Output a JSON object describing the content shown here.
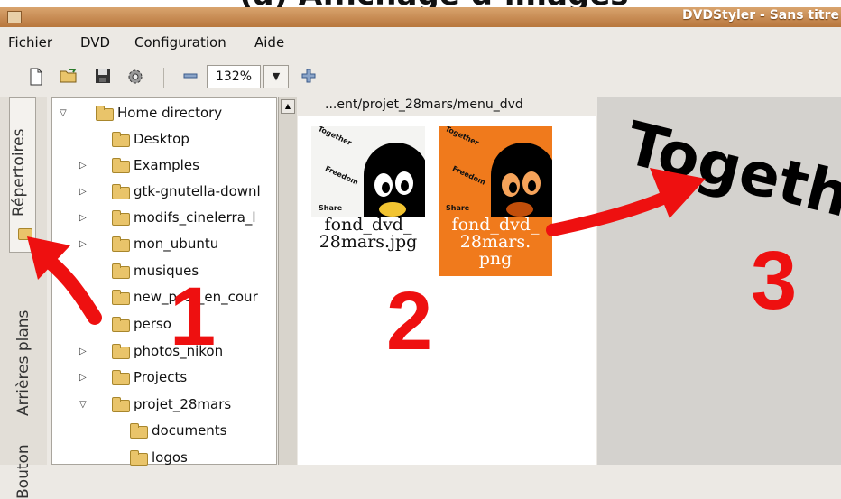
{
  "banner": {
    "text": "(a) Affichage d’images"
  },
  "window": {
    "title": "DVDStyler - Sans titre"
  },
  "menu": [
    "Fichier",
    "DVD",
    "Configuration",
    "Aide"
  ],
  "toolbar": {
    "icons": [
      "new-file-icon",
      "open-folder-icon",
      "save-icon",
      "settings-icon",
      "zoom-out-icon",
      "zoom-in-icon"
    ],
    "zoom_value": "132%"
  },
  "side_tabs": [
    "Répertoires",
    "Arrières plans",
    "Boutons"
  ],
  "tree": [
    {
      "label": "Home directory",
      "expanded": true
    },
    {
      "label": "Desktop"
    },
    {
      "label": "Examples"
    },
    {
      "label": "gtk-gnutella-downl"
    },
    {
      "label": "modifs_cinelerra_l"
    },
    {
      "label": "mon_ubuntu"
    },
    {
      "label": "musiques"
    },
    {
      "label": "new_post_en_cour"
    },
    {
      "label": "perso"
    },
    {
      "label": "photos_nikon"
    },
    {
      "label": "Projects"
    },
    {
      "label": "projet_28mars",
      "expanded": true
    },
    {
      "label": "documents"
    },
    {
      "label": "logos"
    }
  ],
  "path": "...ent/projet_28mars/menu_dvd",
  "files": [
    {
      "caption_line1": "fond_dvd_",
      "caption_line2": "28mars.jpg",
      "selected": false,
      "background": "#ffffff"
    },
    {
      "caption_line1": "fond_dvd_",
      "caption_line2": "28mars.",
      "caption_line3": "png",
      "selected": true,
      "background": "#f07a1c"
    }
  ],
  "thumb_words": [
    "Together",
    "Freedom",
    "Share"
  ],
  "canvas": {
    "text": "Togeth"
  },
  "annotations": [
    "1",
    "2",
    "3"
  ],
  "colors": {
    "selection": "#f07a1c",
    "annotation": "#ee1010",
    "title_bar": "#c98b52"
  }
}
